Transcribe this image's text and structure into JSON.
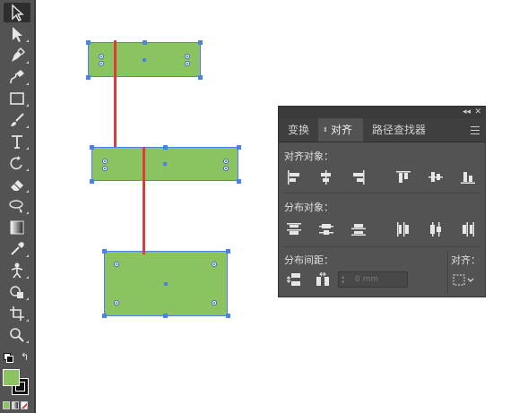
{
  "toolbar": {
    "tools": [
      "selection-tool",
      "direct-selection-tool",
      "pen-tool",
      "curvature-tool",
      "rectangle-tool",
      "paintbrush-tool",
      "type-tool",
      "rotate-tool",
      "eraser-tool",
      "lasso-tool",
      "gradient-tool",
      "eyedropper-tool",
      "puppet-warp-tool",
      "shape-builder-tool",
      "artboard-tool",
      "zoom-tool"
    ],
    "fill_color": "#8bc360",
    "stroke_color": "#ffffff"
  },
  "panel": {
    "collapse_label": "◂◂",
    "close_label": "✕",
    "tabs": [
      "变换",
      "对齐",
      "路径查找器"
    ],
    "active_tab": "对齐",
    "align_objects_label": "对齐对象：",
    "distribute_objects_label": "分布对象：",
    "distribute_spacing_label": "分布间距：",
    "align_to_label": "对齐：",
    "spacing_value": "0 mm"
  },
  "colors": {
    "shape_fill": "#8bc360",
    "selection": "#4a82e6",
    "guide_line": "#e23a3a"
  }
}
